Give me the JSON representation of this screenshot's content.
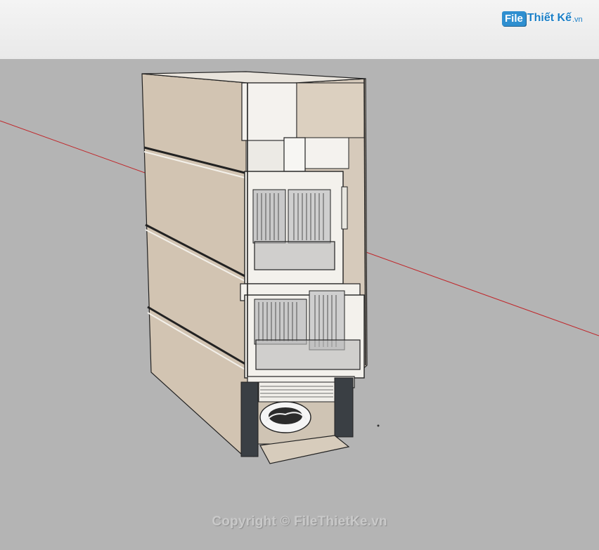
{
  "branding": {
    "logo_box": "File",
    "logo_text": "Thiết Kế",
    "logo_ext": ".vn"
  },
  "footer": {
    "copyright": "Copyright © FileThietKe.vn"
  },
  "colors": {
    "sky": "#ededed",
    "ground": "#b4b4b4",
    "axis_red": "#c0262a",
    "wall": "#d4c8b8",
    "trim": "#f2efe9",
    "dark": "#3a3f44"
  }
}
